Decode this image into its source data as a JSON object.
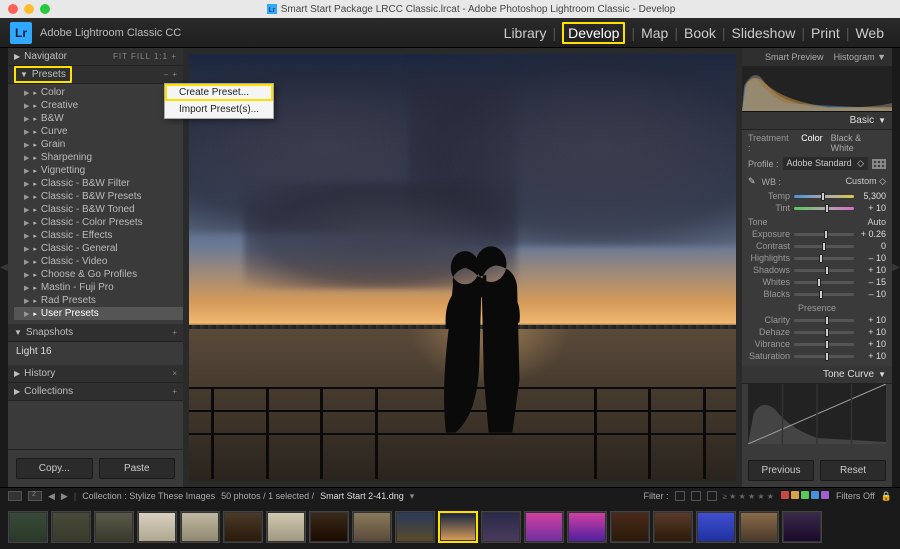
{
  "mac_title": "Smart Start Package LRCC Classic.lrcat - Adobe Photoshop Lightroom Classic - Develop",
  "app_title": "Adobe Lightroom Classic CC",
  "logo_text": "Lr",
  "modules": [
    "Library",
    "Develop",
    "Map",
    "Book",
    "Slideshow",
    "Print",
    "Web"
  ],
  "active_module": "Develop",
  "left": {
    "navigator": {
      "title": "Navigator",
      "modes": "FIT   FILL   1:1   +"
    },
    "presets": {
      "title": "Presets",
      "items": [
        "Color",
        "Creative",
        "B&W",
        "Curve",
        "Grain",
        "Sharpening",
        "Vignetting",
        "Classic - B&W Filter",
        "Classic - B&W Presets",
        "Classic - B&W Toned",
        "Classic - Color Presets",
        "Classic - Effects",
        "Classic - General",
        "Classic - Video",
        "Choose & Go Profiles",
        "Mastin - Fuji Pro",
        "Rad Presets",
        "User Presets"
      ]
    },
    "snapshots": {
      "title": "Snapshots",
      "item": "Light 16"
    },
    "history": {
      "title": "History"
    },
    "collections": {
      "title": "Collections"
    },
    "copy": "Copy...",
    "paste": "Paste"
  },
  "context_menu": {
    "create": "Create Preset...",
    "import": "Import Preset(s)..."
  },
  "right": {
    "smart_preview": "Smart Preview",
    "histogram": "Histogram",
    "basic": {
      "title": "Basic",
      "treatment_label": "Treatment :",
      "treatment_color": "Color",
      "treatment_bw": "Black & White",
      "profile_label": "Profile :",
      "profile_value": "Adobe Standard",
      "wb_label": "WB :",
      "wb_value": "Custom",
      "temp": {
        "lab": "Temp",
        "val": "5,300",
        "pos": 48
      },
      "tint": {
        "lab": "Tint",
        "val": "+ 10",
        "pos": 55
      },
      "tone": "Tone",
      "auto": "Auto",
      "exposure": {
        "lab": "Exposure",
        "val": "+ 0.26",
        "pos": 53
      },
      "contrast": {
        "lab": "Contrast",
        "val": "0",
        "pos": 50
      },
      "highlights": {
        "lab": "Highlights",
        "val": "– 10",
        "pos": 45
      },
      "shadows": {
        "lab": "Shadows",
        "val": "+ 10",
        "pos": 55
      },
      "whites": {
        "lab": "Whites",
        "val": "– 15",
        "pos": 42
      },
      "blacks": {
        "lab": "Blacks",
        "val": "– 10",
        "pos": 45
      },
      "presence": "Presence",
      "clarity": {
        "lab": "Clarity",
        "val": "+ 10",
        "pos": 55
      },
      "dehaze": {
        "lab": "Dehaze",
        "val": "+ 10",
        "pos": 55
      },
      "vibrance": {
        "lab": "Vibrance",
        "val": "+ 10",
        "pos": 55
      },
      "saturation": {
        "lab": "Saturation",
        "val": "+ 10",
        "pos": 55
      }
    },
    "tone_curve": "Tone Curve",
    "previous": "Previous",
    "reset": "Reset"
  },
  "filmstrip": {
    "collection_label": "Collection : Stylize These Images",
    "count": "50 photos / 1 selected /",
    "filename": "Smart Start 2-41.dng",
    "filter_label": "Filter :",
    "filters_off": "Filters Off",
    "label_colors": [
      "#c84848",
      "#d9a048",
      "#5ac85a",
      "#4a90d9",
      "#a060d0"
    ],
    "thumbs": [
      {
        "bg": "linear-gradient(#3a4a3a,#2a3a2a)"
      },
      {
        "bg": "linear-gradient(#4a4a3a,#3a3a2a)"
      },
      {
        "bg": "linear-gradient(#5a5a4a,#3a3a2a)"
      },
      {
        "bg": "linear-gradient(#d9d0c0,#b0a890)"
      },
      {
        "bg": "linear-gradient(#c0b8a0,#908870)"
      },
      {
        "bg": "linear-gradient(#4a3a2a,#2a1a0a)"
      },
      {
        "bg": "linear-gradient(#d0c8b0,#a09880)"
      },
      {
        "bg": "linear-gradient(#3a2a1a,#1a0a00)"
      },
      {
        "bg": "linear-gradient(#8a7a5a,#5a4a3a)"
      },
      {
        "bg": "linear-gradient(#2a3a5a,#5a4a2a)"
      },
      {
        "bg": "linear-gradient(#1a2740,#d49a5a)",
        "sel": true
      },
      {
        "bg": "linear-gradient(#2a2a4a,#4a3a5a)"
      },
      {
        "bg": "linear-gradient(#d040a0,#7030a0)"
      },
      {
        "bg": "linear-gradient(#d040a0,#5020a0)"
      },
      {
        "bg": "linear-gradient(#4a2a1a,#2a1a0a)"
      },
      {
        "bg": "linear-gradient(#5a3a2a,#2a1a0a)"
      },
      {
        "bg": "linear-gradient(#4050d0,#2030a0)"
      },
      {
        "bg": "linear-gradient(#8a6a4a,#4a3a2a)"
      },
      {
        "bg": "linear-gradient(#3a2a4a,#1a0a2a)"
      }
    ]
  }
}
